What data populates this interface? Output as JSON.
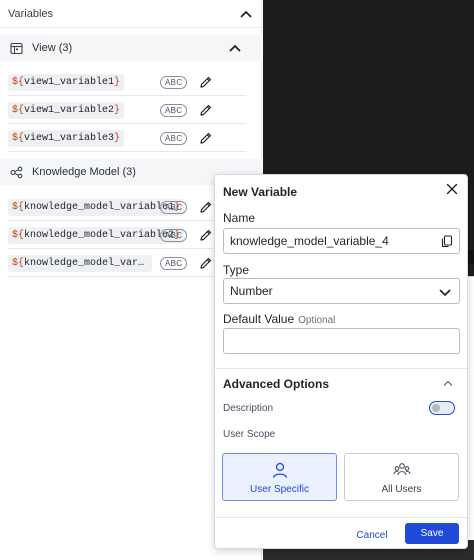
{
  "variables_panel": {
    "title": "Variables",
    "sections": [
      {
        "label": "View (3)",
        "icon": "calendar-grid-icon",
        "items": [
          {
            "name": "view1_variable1",
            "type": "ABC"
          },
          {
            "name": "view1_variable2",
            "type": "ABC"
          },
          {
            "name": "view1_variable3",
            "type": "ABC"
          }
        ]
      },
      {
        "label": "Knowledge Model (3)",
        "icon": "share-nodes-icon",
        "items": [
          {
            "name": "knowledge_model_variable1",
            "type": "ABC"
          },
          {
            "name": "knowledge_model_variable2",
            "type": "ABC"
          },
          {
            "name": "knowledge_model_variable...",
            "type": "ABC"
          }
        ]
      }
    ],
    "dollar_prefix": "${",
    "closing_brace": "}"
  },
  "modal": {
    "title": "New Variable",
    "name_label": "Name",
    "name_value": "knowledge_model_variable_4",
    "type_label": "Type",
    "type_value": "Number",
    "default_label": "Default Value",
    "default_optional": "Optional",
    "default_value": "",
    "advanced_title": "Advanced Options",
    "description_label": "Description",
    "description_toggle_on": false,
    "user_scope_label": "User Scope",
    "scope_options": [
      {
        "label": "User Specific",
        "selected": true
      },
      {
        "label": "All Users",
        "selected": false
      }
    ],
    "cancel_label": "Cancel",
    "save_label": "Save"
  },
  "colors": {
    "accent": "#1f4bd8",
    "dollar": "#c2410c",
    "dark_bg": "#1c1c1c"
  }
}
